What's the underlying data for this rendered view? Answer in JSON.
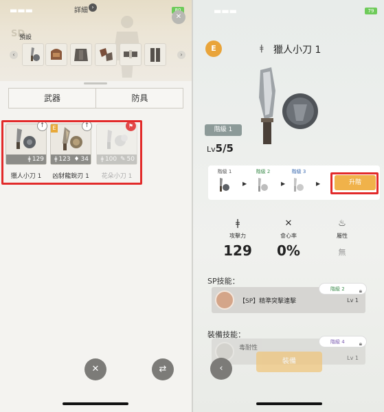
{
  "left": {
    "detail_label": "詳細",
    "battery": "80",
    "preset_label": "預設",
    "tabs": [
      "武器",
      "防具"
    ],
    "weapons": [
      {
        "name": "獵人小刀 1",
        "stat1": "129",
        "stat2": "",
        "badge": "up",
        "dim": false
      },
      {
        "name": "凶豺龍銳刃 1",
        "stat1": "123",
        "stat2": "34",
        "badge": "up",
        "rank": "E",
        "dim": false
      },
      {
        "name": "花朵小刀 1",
        "stat1": "100",
        "stat2": "50",
        "badge": "new",
        "dim": true
      }
    ]
  },
  "right": {
    "battery": "79",
    "rank": "E",
    "item_name": "獵人小刀 1",
    "stage_pill": "階級 1",
    "lv_prefix": "Lv",
    "lv_value": "5/5",
    "stages": [
      "階級 1",
      "階級 2",
      "階級 3"
    ],
    "advance_label": "升階",
    "stats": [
      {
        "label": "攻擊力",
        "value": "129",
        "icon": "attack-icon"
      },
      {
        "label": "會心率",
        "value": "0%",
        "icon": "crit-icon"
      },
      {
        "label": "屬性",
        "value": "無",
        "icon": "element-icon"
      }
    ],
    "sp_skill_title": "SP技能：",
    "sp_skill": {
      "name": "【SP】精準突擊連擊",
      "lv": "Lv 1",
      "lock": "階級 2"
    },
    "equip_skill_title": "裝備技能：",
    "equip_skill": {
      "name": "毒耐性",
      "lv": "Lv 1",
      "lock": "階級 4"
    },
    "equip_button": "裝備"
  },
  "colors": {
    "highlight": "#e22a2a",
    "accent_orange": "#f0b24a",
    "rank_e": "#e9a43a"
  }
}
